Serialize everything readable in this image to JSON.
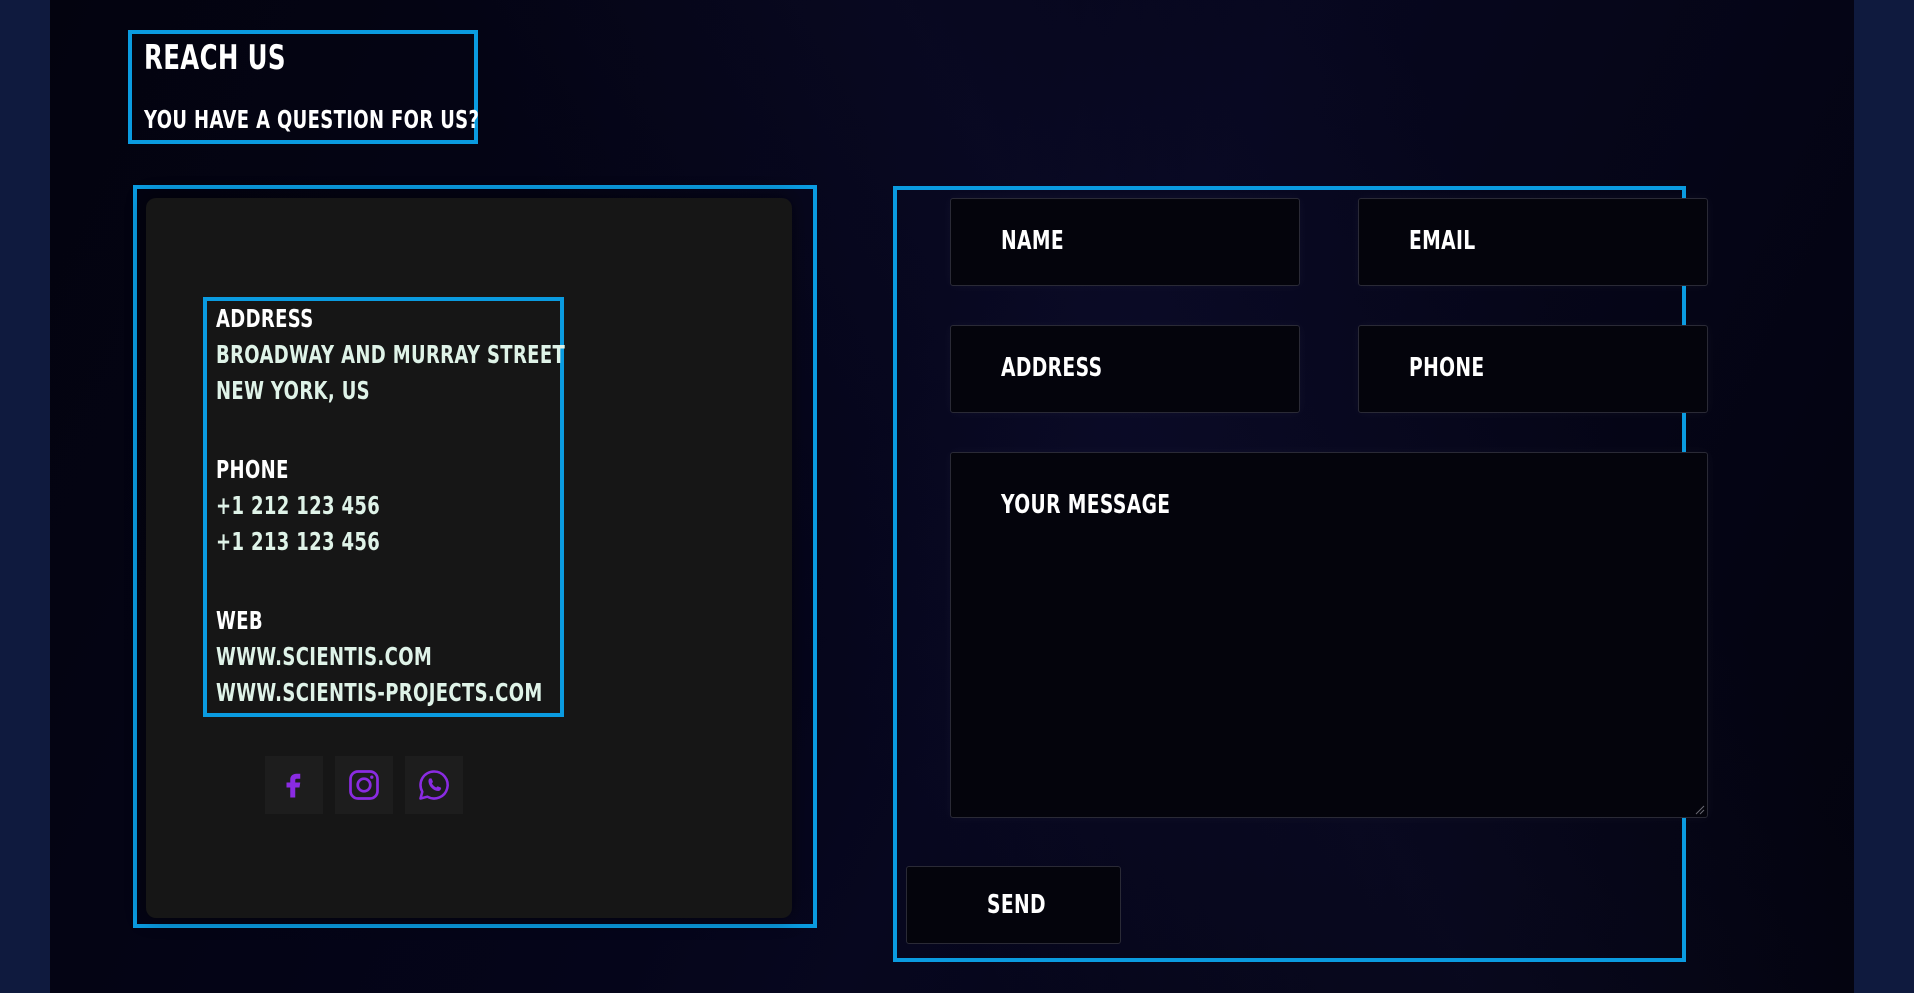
{
  "heading": {
    "title": "REACH US",
    "subtitle": "YOU HAVE A QUESTION FOR US?"
  },
  "contact": {
    "address_label": "ADDRESS",
    "address_line1": "BROADWAY AND MURRAY STREET",
    "address_line2": "NEW YORK, US",
    "phone_label": "PHONE",
    "phone1": "+1 212 123 456",
    "phone2": "+1 213 123 456",
    "web_label": "WEB",
    "web1": "WWW.SCIENTIS.COM",
    "web2": "WWW.SCIENTIS-PROJECTS.COM"
  },
  "social": {
    "icons": [
      "facebook-icon",
      "instagram-icon",
      "whatsapp-icon"
    ],
    "icon_color": "#8a2be2"
  },
  "form": {
    "name_placeholder": "NAME",
    "email_placeholder": "EMAIL",
    "address_placeholder": "ADDRESS",
    "phone_placeholder": "PHONE",
    "message_placeholder": "YOUR MESSAGE",
    "send_label": "SEND"
  },
  "colors": {
    "outline": "#0a9be0",
    "background": "#03030f",
    "card": "#161616"
  }
}
